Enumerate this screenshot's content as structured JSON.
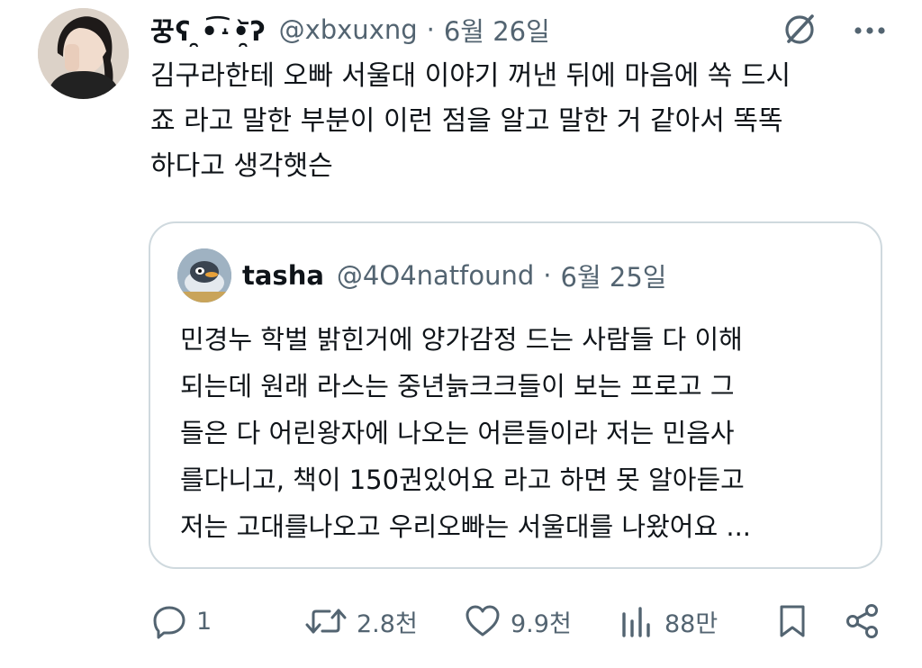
{
  "tweet": {
    "display_name": "꿍ʕ ̯•͡˔•̯᷅ʔ",
    "handle": "@xbxuxng",
    "separator": "·",
    "date": "6월 26일",
    "text_lines": [
      "김구라한테 오빠 서울대 이야기 꺼낸 뒤에 마음에 쏙 드시",
      "죠 라고 말한 부분이 이런 점을 알고 말한 거 같아서 똑똑",
      "하다고 생각햇슨"
    ]
  },
  "quoted_tweet": {
    "display_name": "tasha",
    "handle": "@4O4natfound",
    "separator": "·",
    "date": "6월 25일",
    "text_lines": [
      "민경누 학벌 밝힌거에 양가감정 드는 사람들 다 이해",
      "되는데 원래 라스는 중년늙크크들이 보는 프로고 그",
      "들은 다 어린왕자에 나오는 어른들이라 저는 민음사",
      "를다니고, 책이 150권있어요 라고 하면 못 알아듣고",
      "저는 고대를나오고 우리오빠는 서울대를 나왔어요 ..."
    ]
  },
  "actions": {
    "replies": "1",
    "retweets": "2.8천",
    "likes": "9.9천",
    "views": "88만"
  },
  "icons": {
    "top": [
      "grok-icon",
      "more-icon"
    ],
    "actions": [
      "reply-icon",
      "retweet-icon",
      "like-icon",
      "views-icon",
      "bookmark-icon",
      "share-icon"
    ]
  },
  "colors": {
    "text": "#0f1419",
    "secondary": "#536471",
    "border": "#cfd9de",
    "background": "#ffffff"
  }
}
